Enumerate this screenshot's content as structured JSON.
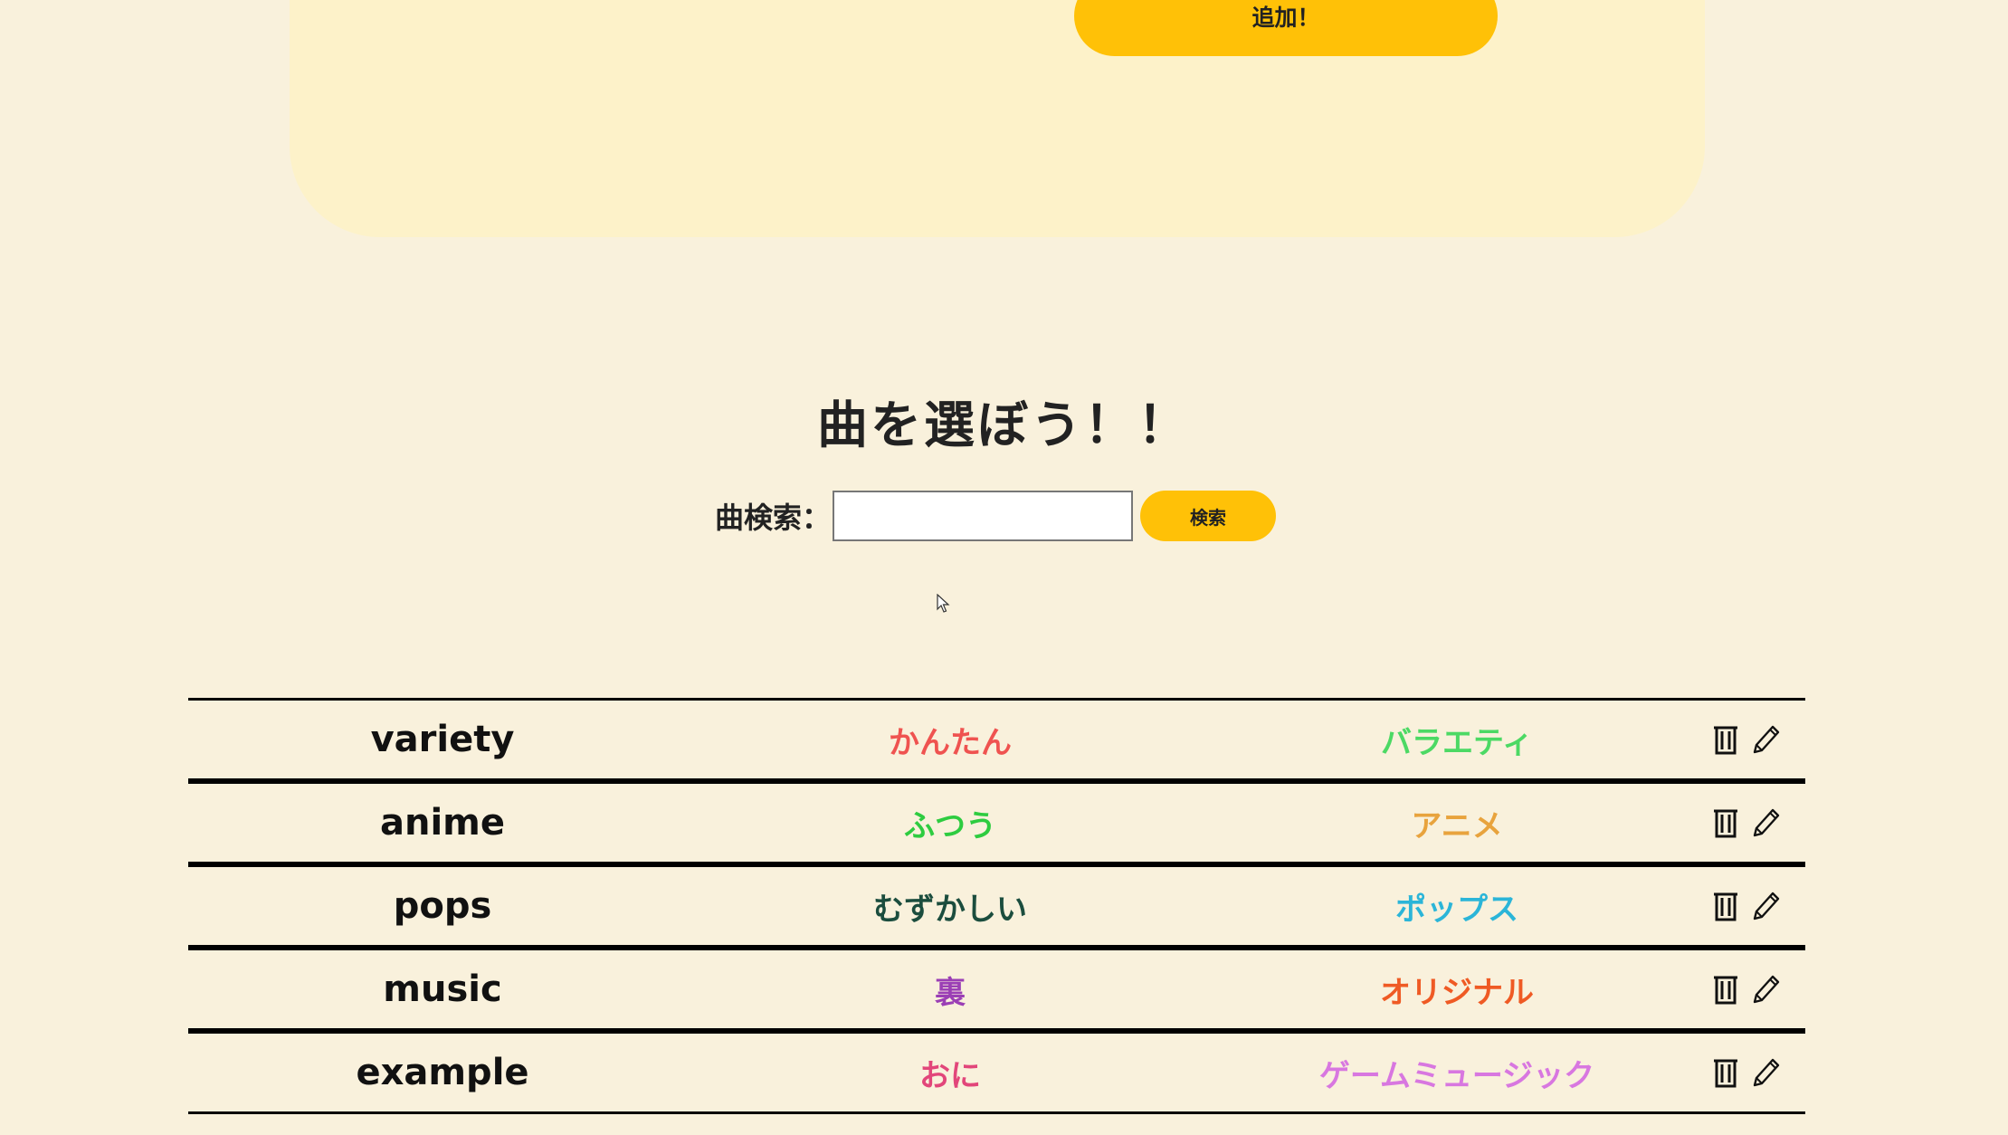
{
  "add_section": {
    "button_label": "追加！"
  },
  "song_select": {
    "title": "曲を選ぼう！！",
    "search_label": "曲検索：",
    "search_value": "",
    "search_button": "検索"
  },
  "songs": [
    {
      "name": "variety",
      "level": "かんたん",
      "level_color": "#ef5350",
      "genre": "バラエティ",
      "genre_color": "#4cd964",
      "delete_icon": "trash-icon",
      "edit_icon": "pencil-icon"
    },
    {
      "name": "anime",
      "level": "ふつう",
      "level_color": "#2ecc40",
      "genre": "アニメ",
      "genre_color": "#e8a33d",
      "delete_icon": "trash-icon",
      "edit_icon": "pencil-icon"
    },
    {
      "name": "pops",
      "level": "むずかしい",
      "level_color": "#1b4d3e",
      "genre": "ポップス",
      "genre_color": "#2bb5d8",
      "delete_icon": "trash-icon",
      "edit_icon": "pencil-icon"
    },
    {
      "name": "music",
      "level": "裏",
      "level_color": "#9b3fb5",
      "genre": "オリジナル",
      "genre_color": "#ef5a24",
      "delete_icon": "trash-icon",
      "edit_icon": "pencil-icon"
    },
    {
      "name": "example",
      "level": "おに",
      "level_color": "#e2467a",
      "genre": "ゲームミュージック",
      "genre_color": "#d877e0",
      "delete_icon": "trash-icon",
      "edit_icon": "pencil-icon"
    }
  ]
}
